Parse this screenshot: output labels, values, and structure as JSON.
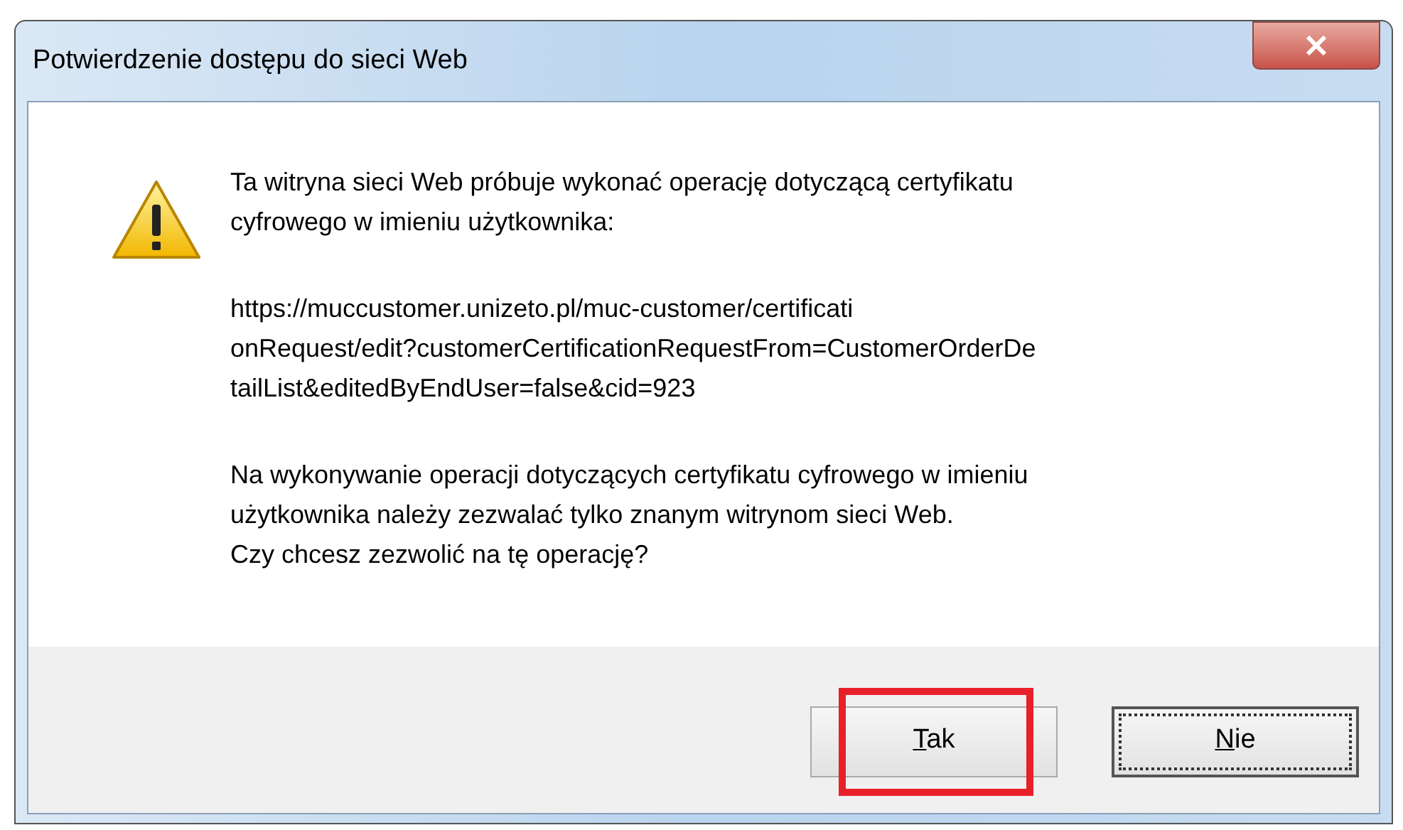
{
  "window": {
    "title": "Potwierdzenie dostępu do sieci Web"
  },
  "message": {
    "intro_lines": [
      "Ta witryna sieci Web próbuje wykonać operację dotyczącą certyfikatu",
      "cyfrowego w imieniu użytkownika:"
    ],
    "url_lines": [
      "https://muccustomer.unizeto.pl/muc-customer/certificati",
      "onRequest/edit?customerCertificationRequestFrom=CustomerOrderDe",
      "tailList&editedByEndUser=false&cid=923"
    ],
    "warning_lines": [
      "Na wykonywanie operacji dotyczących certyfikatu cyfrowego w imieniu",
      "użytkownika należy zezwalać tylko znanym witrynom sieci Web.",
      "Czy chcesz zezwolić na tę operację?"
    ]
  },
  "buttons": [
    {
      "label": "Tak",
      "underline_first": true,
      "focused": false,
      "highlighted": true
    },
    {
      "label": "Nie",
      "underline_first": true,
      "focused": true,
      "highlighted": false
    }
  ]
}
